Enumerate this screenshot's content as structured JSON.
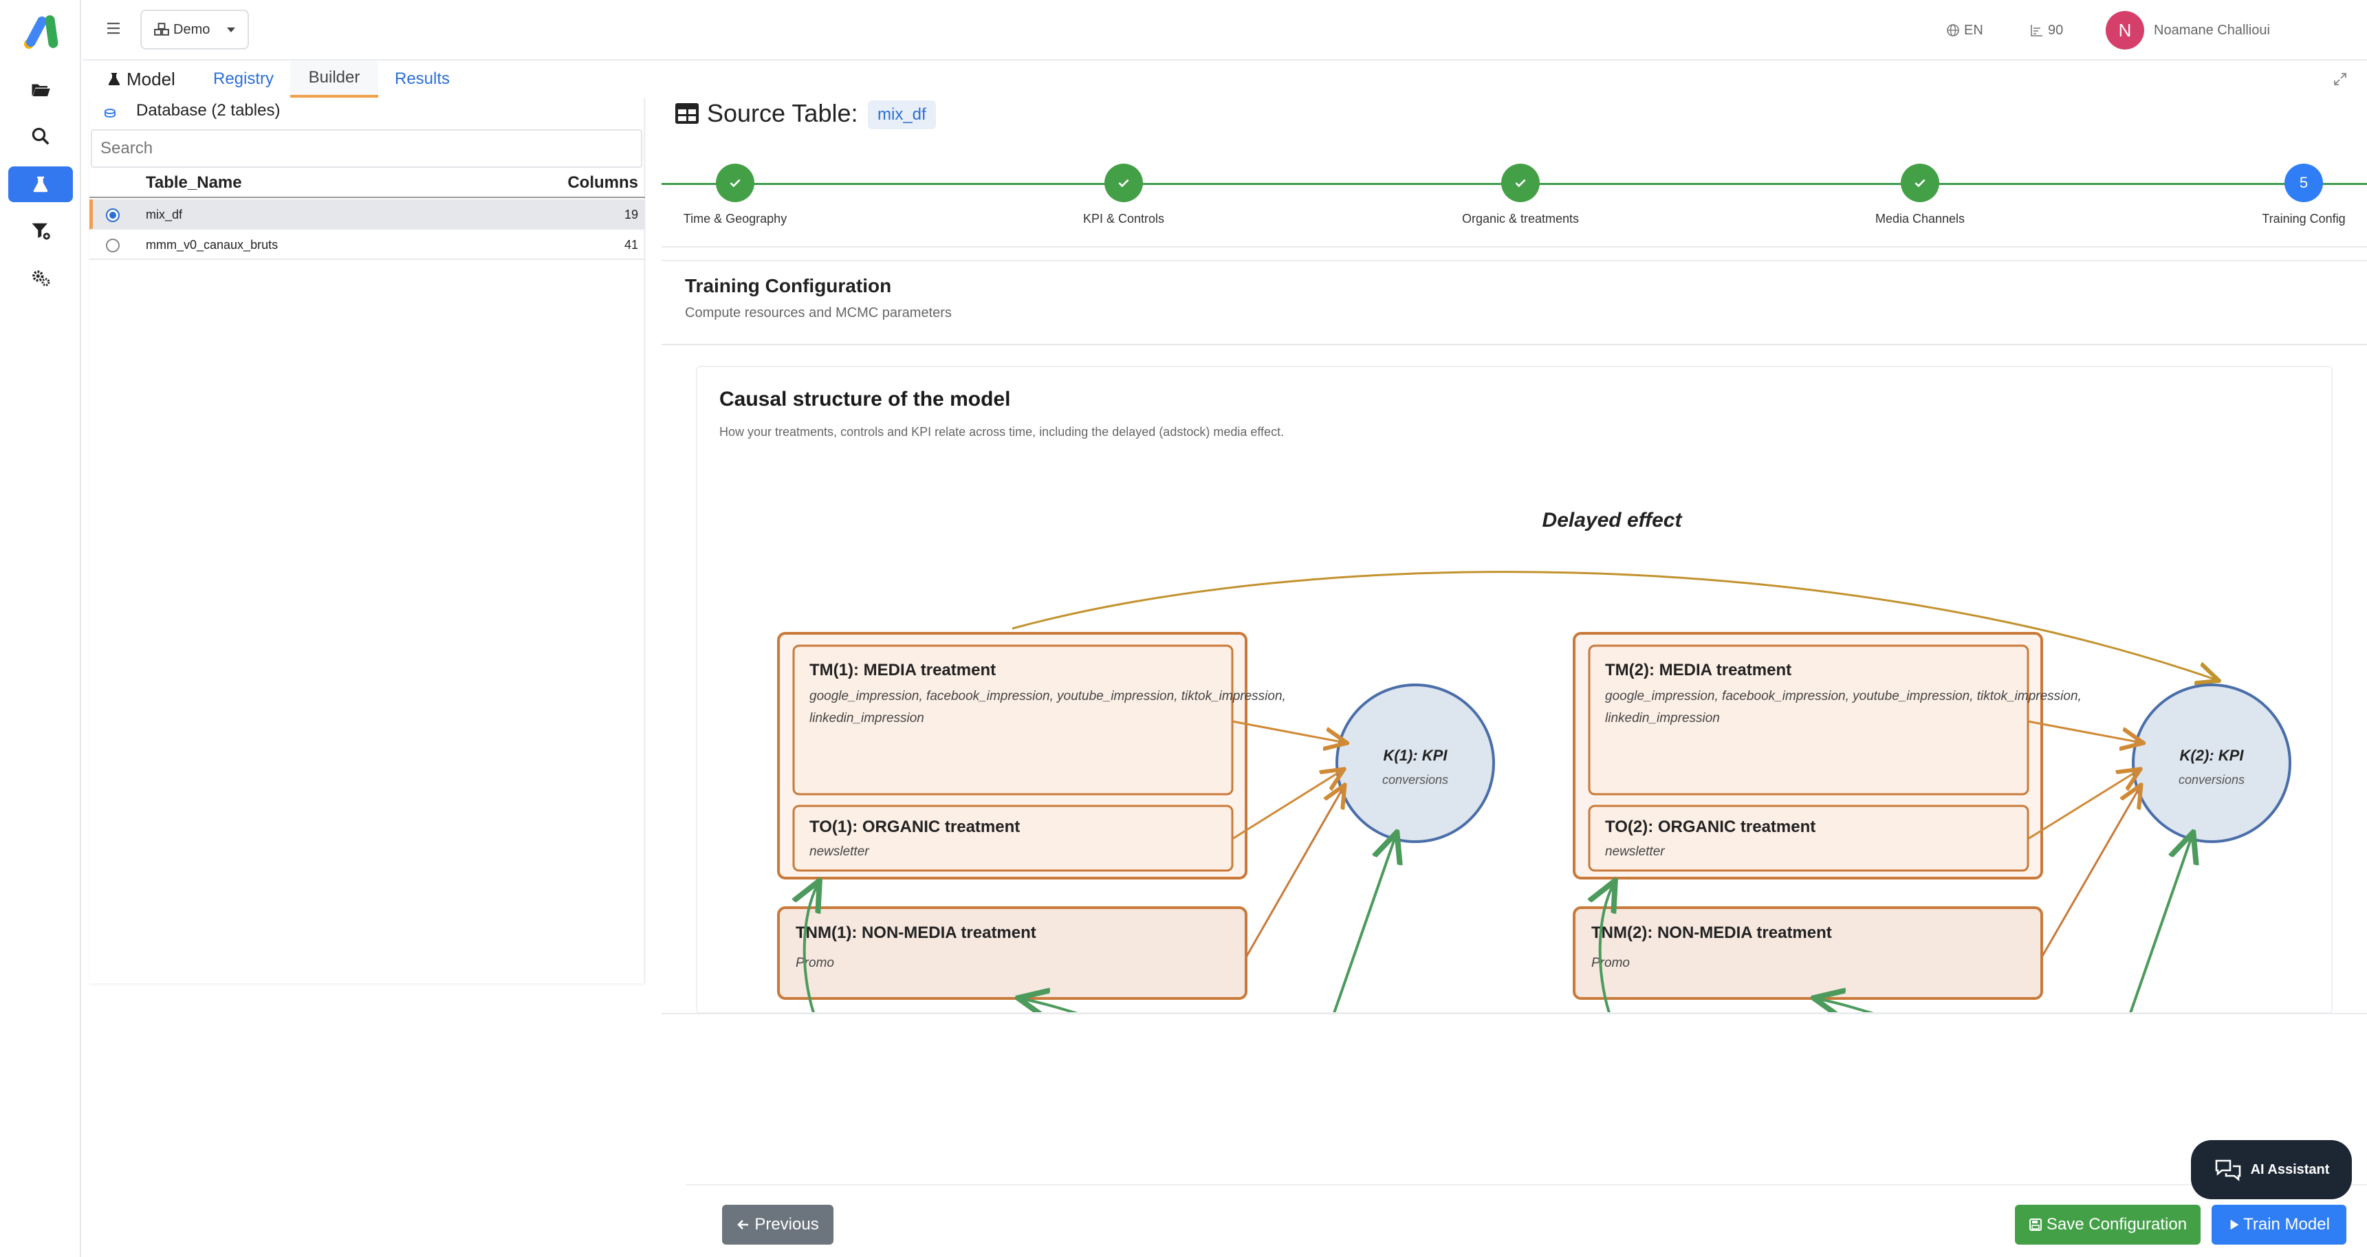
{
  "app": {
    "workspace": "Demo",
    "language": "EN",
    "credits": "90",
    "user_initial": "N",
    "user_name": "Noamane Challioui"
  },
  "sidebar": {
    "items": [
      {
        "icon": "folder-icon",
        "active": false
      },
      {
        "icon": "search-icon",
        "active": false
      },
      {
        "icon": "flask-icon",
        "active": true
      },
      {
        "icon": "filter-icon",
        "active": false
      },
      {
        "icon": "gears-icon",
        "active": false
      }
    ]
  },
  "tabs": {
    "model": "Model",
    "registry": "Registry",
    "builder": "Builder",
    "results": "Results"
  },
  "database": {
    "title": "Database (2 tables)",
    "search_placeholder": "Search",
    "columns": [
      "Table_Name",
      "Columns"
    ],
    "rows": [
      {
        "name": "mix_df",
        "columns": "19",
        "selected": true
      },
      {
        "name": "mmm_v0_canaux_bruts",
        "columns": "41",
        "selected": false
      }
    ]
  },
  "source": {
    "label": "Source Table:",
    "table": "mix_df"
  },
  "steps": [
    {
      "number": "1",
      "label": "Time & Geography",
      "done": true
    },
    {
      "number": "2",
      "label": "KPI & Controls",
      "done": true
    },
    {
      "number": "3",
      "label": "Organic & treatments",
      "done": true
    },
    {
      "number": "4",
      "label": "Media Channels",
      "done": true
    },
    {
      "number": "5",
      "label": "Training Config",
      "done": false
    }
  ],
  "config": {
    "title": "Training Configuration",
    "subtitle": "Compute resources and MCMC parameters"
  },
  "causal": {
    "title": "Causal structure of the model",
    "subtitle": "How your treatments, controls and KPI relate across time, including the delayed (adstock) media effect.",
    "delayed_label": "Delayed effect",
    "periods": [
      {
        "media_title": "TM(1): MEDIA treatment",
        "media_line1": "google_impression, facebook_impression, youtube_impression, tiktok_impression,",
        "media_line2": "linkedin_impression",
        "organic_title": "TO(1): ORGANIC treatment",
        "organic_sub": "newsletter",
        "nonmedia_title": "TNM(1): NON-MEDIA treatment",
        "nonmedia_sub": "Promo",
        "kpi_title": "K(1): KPI",
        "kpi_sub": "conversions"
      },
      {
        "media_title": "TM(2): MEDIA treatment",
        "media_line1": "google_impression, facebook_impression, youtube_impression, tiktok_impression,",
        "media_line2": "linkedin_impression",
        "organic_title": "TO(2): ORGANIC treatment",
        "organic_sub": "newsletter",
        "nonmedia_title": "TNM(2): NON-MEDIA treatment",
        "nonmedia_sub": "Promo",
        "kpi_title": "K(2): KPI",
        "kpi_sub": "conversions"
      }
    ],
    "colors": {
      "treatment_stroke": "#c97a3a",
      "treatment_fill": "#fcefe6",
      "nonmedia_fill": "#f6e8df",
      "kpi_stroke": "#4a6ea9",
      "kpi_fill": "#dde5ef",
      "edge": "#d08a36",
      "delayed_edge": "#c2922e",
      "control_edge": "#4c9a5c"
    }
  },
  "footer": {
    "previous": "Previous",
    "save": "Save Configuration",
    "train": "Train Model"
  },
  "assistant": {
    "label": "AI Assistant"
  }
}
